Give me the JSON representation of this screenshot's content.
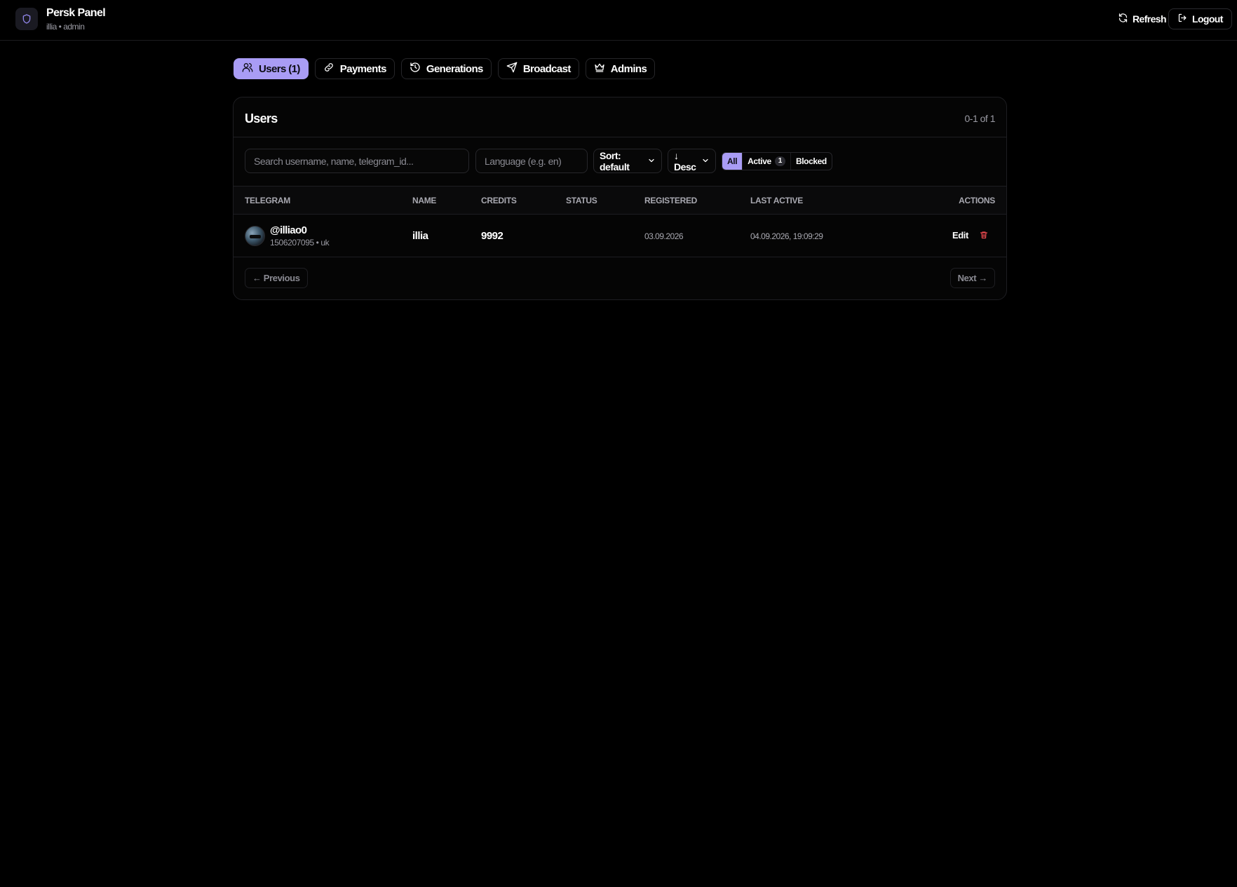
{
  "header": {
    "title": "Persk Panel",
    "subtitle": "illia • admin",
    "refresh_label": "Refresh",
    "logout_label": "Logout"
  },
  "tabs": [
    {
      "label": "Users (1)",
      "icon": "users-icon",
      "active": true
    },
    {
      "label": "Payments",
      "icon": "link-icon",
      "active": false
    },
    {
      "label": "Generations",
      "icon": "history-icon",
      "active": false
    },
    {
      "label": "Broadcast",
      "icon": "send-icon",
      "active": false
    },
    {
      "label": "Admins",
      "icon": "crown-icon",
      "active": false
    }
  ],
  "users_card": {
    "title": "Users",
    "range": "0-1 of 1",
    "filters": {
      "search_placeholder": "Search username, name, telegram_id...",
      "search_value": "",
      "language_placeholder": "Language (e.g. en)",
      "language_value": "",
      "sort_value": "Sort: default",
      "order_value": "↓ Desc",
      "status_segments": [
        {
          "label": "All",
          "active": true
        },
        {
          "label": "Active",
          "count": "1",
          "active": false
        },
        {
          "label": "Blocked",
          "active": false
        }
      ]
    },
    "columns": [
      "Telegram",
      "Name",
      "Credits",
      "Status",
      "Registered",
      "Last active",
      "Actions"
    ],
    "rows": [
      {
        "username": "@illiao0",
        "telegram_meta": "1506207095 • uk",
        "name": "illia",
        "credits": "9992",
        "status": "",
        "registered": "03.09.2026",
        "last_active": "04.09.2026, 19:09:29",
        "edit_label": "Edit"
      }
    ],
    "pagination": {
      "prev_label": "← Previous",
      "next_label": "Next →"
    }
  },
  "colors": {
    "accent": "#a99cf5",
    "background": "#000000",
    "danger": "#e5484d"
  }
}
